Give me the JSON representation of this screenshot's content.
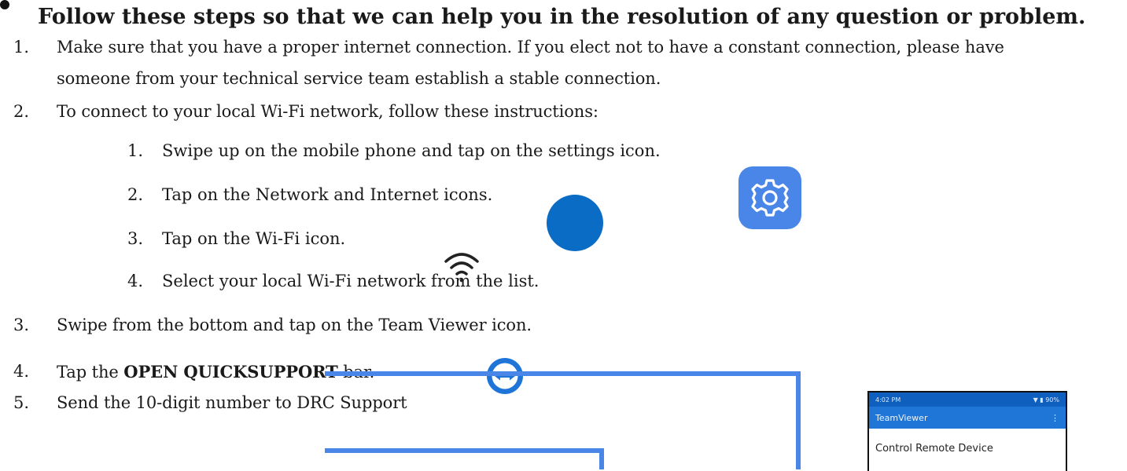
{
  "heading": "Follow these steps so that we can help you in the resolution of any question or problem.",
  "steps": [
    {
      "num": "1.",
      "text_line1": "Make sure that you have a proper internet connection. If you elect not to have a constant connection, please have",
      "text_line2": "someone from your technical service team establish a stable connection."
    },
    {
      "num": "2.",
      "text": "To connect to your local Wi-Fi network, follow these instructions:"
    },
    {
      "num": "3.",
      "text": "Swipe from the bottom and tap on the Team Viewer icon."
    },
    {
      "num": "4.",
      "text_prefix": "Tap the ",
      "text_bold": "OPEN QUICKSUPPORT",
      "text_suffix": " bar."
    },
    {
      "num": "5.",
      "text": "Send the 10-digit number to DRC Support"
    }
  ],
  "substeps": [
    {
      "num": "1.",
      "text": "Swipe up on the mobile phone and tap on the settings icon."
    },
    {
      "num": "2.",
      "text": "Tap on the Network and Internet icons."
    },
    {
      "num": "3.",
      "text": "Tap on the Wi-Fi icon."
    },
    {
      "num": "4.",
      "text": "Select your local Wi-Fi network from the list."
    }
  ],
  "icons": {
    "settings": "settings-gear-icon",
    "network": "network-internet-icon",
    "wifi": "wifi-icon",
    "teamviewer": "teamviewer-icon"
  },
  "colors": {
    "settings_tile": "#4a86e8",
    "network_circle": "#0a6cc4",
    "connector": "#4a86e8",
    "phone_appbar": "#1f76d6"
  },
  "phone": {
    "time": "4:02 PM",
    "signal": "▼ ▮ 90%",
    "app_title": "TeamViewer",
    "menu": "⋮",
    "first_item": "Control Remote Device"
  }
}
